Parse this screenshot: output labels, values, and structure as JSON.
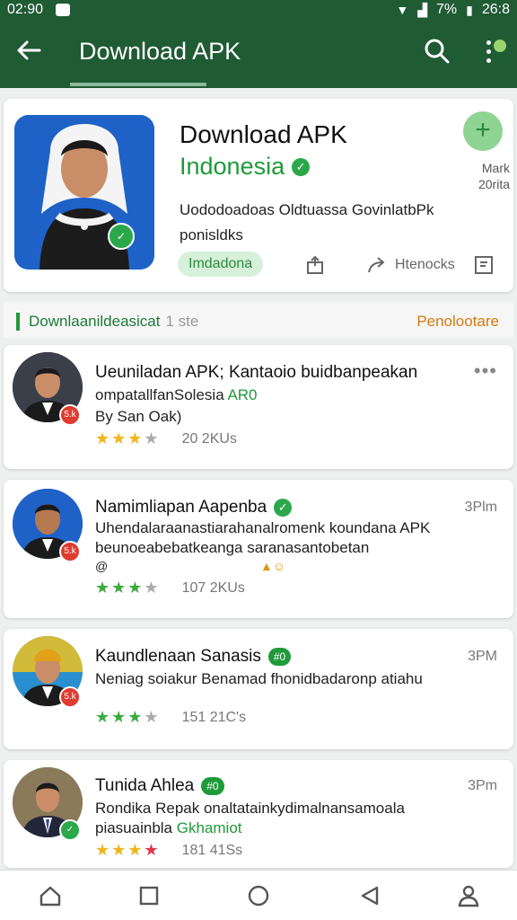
{
  "status_bar": {
    "time": "02:90",
    "battery": "7%",
    "clock_right": "26:8"
  },
  "app_bar": {
    "title": "Download APK",
    "back_icon": "arrow-left-icon",
    "search_icon": "search-icon",
    "more_icon": "more-vertical-icon"
  },
  "hero": {
    "title": "Download APK",
    "subtitle": "Indonesia",
    "description": "Uododoadoas Oldtuassa GovinlatbPk ponisldks",
    "chip": "Imdadona",
    "share_action": "Htenocks",
    "mark_label": "Mark\n20rita",
    "colors": {
      "accent": "#1f9a3a",
      "brand": "#1f5b33"
    }
  },
  "section": {
    "label": "Downlaanildeasicat",
    "label_muted": "1 ste",
    "right": "Penolootare"
  },
  "items": [
    {
      "name": "Ueuniladan APK; Kantaoio buidbanpeakan",
      "line1_a": "ompatallfanSolesia ",
      "line1_b": "AR0",
      "line2": "By San Oak)",
      "count": "20 2KUs",
      "stars": 3
    },
    {
      "name": "Namimliapan Aapenba",
      "line1": "Uhendalaraanastiarahanalromenk koundana APK",
      "line2": "beunoeabebatkeanga saranasantobetan",
      "line3": "@",
      "count": "107 2KUs",
      "time": "3Plm",
      "stars": 3
    },
    {
      "name": "Kaundlenaan Sanasis",
      "tag": "#0",
      "line1": "Neniag soiakur Benamad fhonidbadaronp atiahu",
      "count": "151 21C's",
      "time": "3PM",
      "stars": 3
    },
    {
      "name": "Tunida Ahlea",
      "tag": "#0",
      "line1": "Rondika Repak onaltatainkydimalnansamoala",
      "line2_a": "piasuainbla ",
      "line2_b": "Gkhamiot",
      "count": "181 41Ss",
      "time": "3Pm",
      "stars": 3
    }
  ]
}
